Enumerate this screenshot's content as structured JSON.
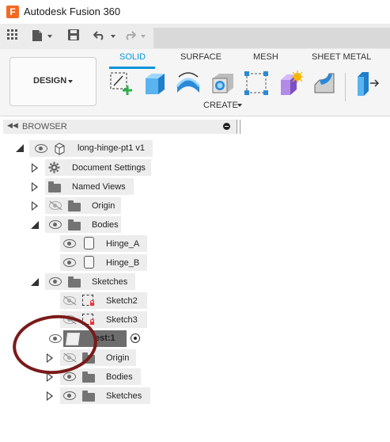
{
  "window": {
    "title": "Autodesk Fusion 360",
    "logo_letter": "F",
    "accent": "#f26a21"
  },
  "workspace": {
    "label": "DESIGN"
  },
  "ribbon": {
    "tabs": [
      "SOLID",
      "SURFACE",
      "MESH",
      "SHEET METAL"
    ],
    "active_tab": "SOLID",
    "active_color": "#0696d7",
    "panel_label": "CREATE",
    "tools": [
      "create-sketch-icon",
      "extrude-icon",
      "revolve-icon",
      "hole-icon",
      "rectangular-pattern-icon",
      "new-component-icon",
      "fillet-icon",
      "modify-press-pull-icon"
    ]
  },
  "browser": {
    "title": "BROWSER",
    "root": {
      "label": "long-hinge-pt1 v1"
    },
    "items": [
      {
        "label": "Document Settings"
      },
      {
        "label": "Named Views"
      },
      {
        "label": "Origin"
      },
      {
        "label": "Bodies"
      },
      {
        "label": "Hinge_A"
      },
      {
        "label": "Hinge_B"
      },
      {
        "label": "Sketches"
      },
      {
        "label": "Sketch2"
      },
      {
        "label": "Sketch3"
      },
      {
        "label": "est:1"
      },
      {
        "label": "Origin"
      },
      {
        "label": "Bodies"
      },
      {
        "label": "Sketches"
      }
    ]
  },
  "annotation": {
    "color": "#7a1a1a"
  }
}
